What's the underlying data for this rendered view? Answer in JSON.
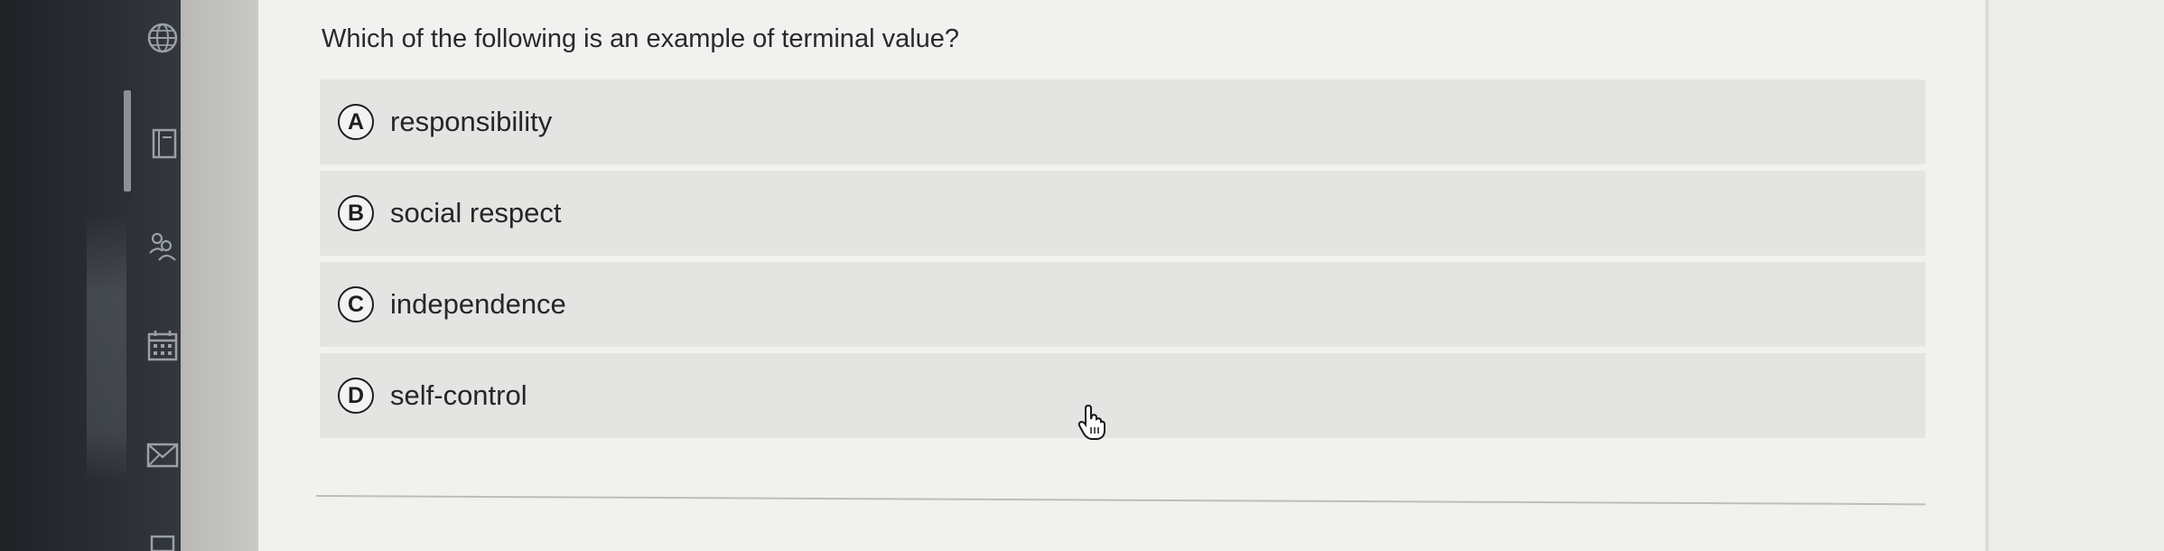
{
  "question": {
    "text": "Which of the following is an example of terminal value?"
  },
  "options": [
    {
      "letter": "A",
      "label": "responsibility"
    },
    {
      "letter": "B",
      "label": "social respect"
    },
    {
      "letter": "C",
      "label": "independence"
    },
    {
      "letter": "D",
      "label": "self-control"
    }
  ],
  "sidebar": {
    "icons": [
      "globe-icon",
      "gradebook-icon",
      "people-icon",
      "calendar-icon",
      "mail-icon"
    ]
  },
  "colors": {
    "rail": "#2a2e33",
    "content_bg": "#f1f1ef",
    "option_bg": "#e4e4e2",
    "text": "#262626"
  }
}
